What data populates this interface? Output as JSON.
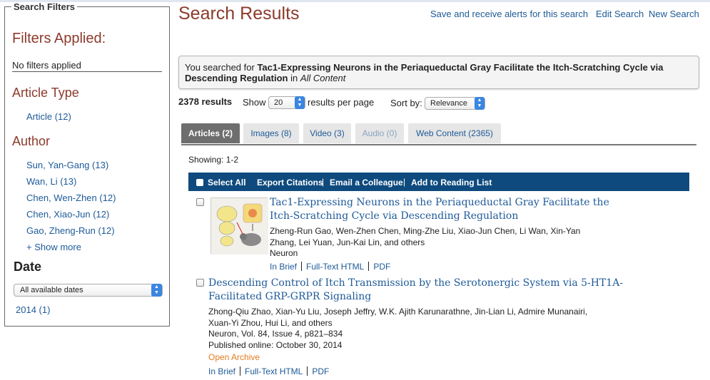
{
  "sidebar": {
    "legend": "Search Filters",
    "filters_applied_heading": "Filters Applied:",
    "no_filters_text": "No filters applied",
    "article_type_heading": "Article Type",
    "article_type_items": [
      {
        "label": "Article (12)"
      }
    ],
    "author_heading": "Author",
    "authors": [
      {
        "label": "Sun, Yan-Gang (13)"
      },
      {
        "label": "Wan, Li (13)"
      },
      {
        "label": "Chen, Wen-Zhen (12)"
      },
      {
        "label": "Chen, Xiao-Jun (12)"
      },
      {
        "label": "Gao, Zheng-Run (12)"
      }
    ],
    "show_more": "+ Show more",
    "date_heading": "Date",
    "date_select_value": "All available dates",
    "years": [
      {
        "label": "2014 (1)"
      }
    ]
  },
  "header": {
    "title": "Search Results",
    "links": [
      "Save and receive alerts for this search",
      "Edit Search",
      "New Search"
    ]
  },
  "search_summary": {
    "prefix": "You searched for ",
    "query": "Tac1-Expressing Neurons in the Periaqueductal Gray Facilitate the Itch-Scratching Cycle via Descending Regulation",
    "in_text": " in ",
    "scope": "All Content"
  },
  "results_bar": {
    "count": "2378 results",
    "show_label": "Show",
    "per_page_value": "20",
    "per_page_label": "results per page",
    "sort_label": "Sort by:",
    "sort_value": "Relevance"
  },
  "tabs": [
    {
      "label": "Articles (2)",
      "state": "active"
    },
    {
      "label": "Images (8)",
      "state": "normal"
    },
    {
      "label": "Video (3)",
      "state": "normal"
    },
    {
      "label": "Audio (0)",
      "state": "disabled"
    },
    {
      "label": "Web Content (2365)",
      "state": "normal"
    }
  ],
  "showing": "Showing: 1-2",
  "actions": {
    "select_all": "Select All",
    "export": "Export Citations",
    "email": "Email a Colleague",
    "reading_list": "Add to Reading List",
    "separator": "|"
  },
  "results": [
    {
      "title_line1": "Tac1-Expressing Neurons in the Periaqueductal Gray Facilitate the",
      "title_line2": "Itch-Scratching Cycle via Descending Regulation",
      "authors_line1": "Zheng-Run Gao, Wen-Zhen Chen, Ming-Zhe Liu, Xiao-Jun Chen, Li Wan, Xin-Yan",
      "authors_line2": "Zhang, Lei Yuan, Jun-Kai Lin, and others",
      "journal": "Neuron",
      "links": [
        "In Brief",
        "Full-Text HTML",
        "PDF"
      ]
    },
    {
      "title_line1": "Descending Control of Itch Transmission by the Serotonergic System via 5-HT1A-",
      "title_line2": "Facilitated GRP-GRPR Signaling",
      "authors_line1": "Zhong-Qiu Zhao, Xian-Yu Liu, Joseph Jeffry, W.K. Ajith Karunarathne, Jin-Lian Li, Admire Munanairi,",
      "authors_line2": "Xuan-Yi Zhou, Hui Li, and others",
      "citation": "Neuron, Vol. 84, Issue 4, p821–834",
      "published": "Published online: October 30, 2014",
      "access": "Open Archive",
      "links": [
        "In Brief",
        "Full-Text HTML",
        "PDF"
      ]
    }
  ],
  "colors": {
    "heading_red": "#8b3a2b",
    "link_blue": "#1e5a98",
    "action_bar": "#0e4a7e",
    "open_archive": "#e07b1f",
    "tab_active": "#6e6e6e"
  }
}
